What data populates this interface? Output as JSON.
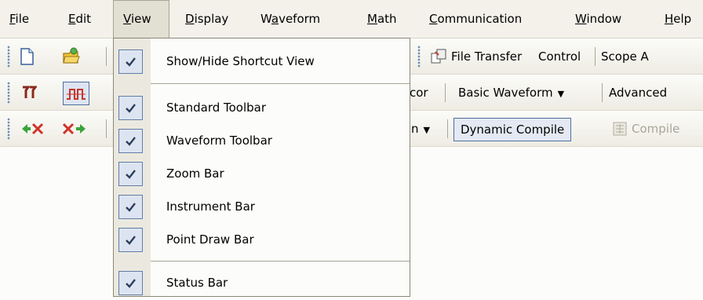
{
  "menubar": {
    "items": [
      {
        "mnemonic": "F",
        "rest": "ile"
      },
      {
        "mnemonic": "E",
        "rest": "dit"
      },
      {
        "mnemonic": "V",
        "rest": "iew"
      },
      {
        "mnemonic": "D",
        "rest": "isplay"
      },
      {
        "pre": "W",
        "mnemonic": "a",
        "rest": "veform"
      },
      {
        "mnemonic": "M",
        "rest": "ath"
      },
      {
        "mnemonic": "C",
        "rest": "ommunication"
      },
      {
        "mnemonic": "W",
        "rest": "indow"
      },
      {
        "mnemonic": "H",
        "rest": "elp"
      }
    ],
    "open_item": "View"
  },
  "toolbar1": {
    "icons": [
      "new-document-icon",
      "open-folder-icon"
    ],
    "file_transfer_label": "File Transfer",
    "control_label": "Control",
    "scope_label": "Scope A"
  },
  "toolbar2": {
    "icons": [
      "cursor-markers-icon",
      "waveform-square-icon"
    ],
    "partial_label": "cor",
    "basic_waveform_label": "Basic Waveform",
    "advanced_label": "Advanced"
  },
  "toolbar3": {
    "icons": [
      "arrows-inward-icon",
      "arrows-outward-icon"
    ],
    "partial_label": "n",
    "dynamic_compile_label": "Dynamic Compile",
    "compile_label": "Compile"
  },
  "view_menu": {
    "items": [
      {
        "label": "Show/Hide Shortcut View",
        "checked": true
      },
      {
        "label": "Standard Toolbar",
        "checked": true
      },
      {
        "label": "Waveform Toolbar",
        "checked": true
      },
      {
        "label": "Zoom Bar",
        "checked": true
      },
      {
        "label": "Instrument Bar",
        "checked": true
      },
      {
        "label": "Point Draw Bar",
        "checked": true
      },
      {
        "label": "Status Bar",
        "checked": true
      }
    ]
  },
  "colors": {
    "menubar_bg": "#f3f1ea",
    "menu_gutter": "#ebe9df",
    "check_box_fill": "#dde4f1",
    "check_border": "#5f7da8",
    "check_mark": "#2b3f5c"
  }
}
